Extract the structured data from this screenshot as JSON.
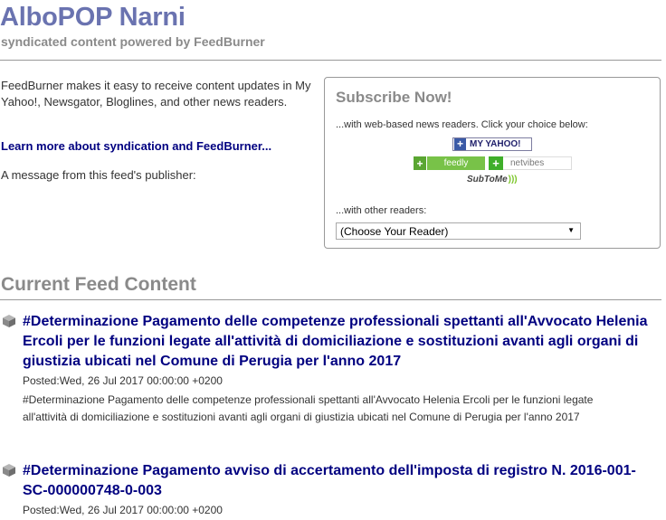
{
  "header": {
    "title": "AlboPOP Narni",
    "subtitle": "syndicated content powered by FeedBurner"
  },
  "intro": {
    "text": "FeedBurner makes it easy to receive content updates in My Yahoo!, Newsgator, Bloglines, and other news readers.",
    "learn_more_link": "Learn more about syndication and FeedBurner...",
    "publisher_message": "A message from this feed's publisher:"
  },
  "subscribe": {
    "title": "Subscribe Now!",
    "web_readers_text": "...with web-based news readers. Click your choice below:",
    "buttons": {
      "myyahoo": "MY YAHOO!",
      "feedly": "feedly",
      "netvibes": "netvibes",
      "subtome": "SubToMe"
    },
    "other_readers_text": "...with other readers:",
    "select_value": "(Choose Your Reader)"
  },
  "content": {
    "heading": "Current Feed Content",
    "items": [
      {
        "title": "#Determinazione Pagamento delle competenze professionali spettanti all'Avvocato Helenia Ercoli per le funzioni legate all'attività di domiciliazione e sostituzioni avanti agli organi di giustizia ubicati nel Comune di Perugia per l'anno 2017",
        "posted": "Posted:Wed, 26 Jul 2017 00:00:00 +0200",
        "body": "#Determinazione Pagamento delle competenze professionali spettanti all'Avvocato Helenia Ercoli per le funzioni legate all'attività di domiciliazione e sostituzioni avanti agli organi di giustizia ubicati nel Comune di Perugia per l'anno 2017"
      },
      {
        "title": "#Determinazione Pagamento avviso di accertamento dell'imposta di registro N. 2016-001-SC-000000748-0-003",
        "posted": "Posted:Wed, 26 Jul 2017 00:00:00 +0200"
      }
    ]
  },
  "colors": {
    "title": "#6a73b0",
    "link": "#000080",
    "muted_heading": "#8a8a8a",
    "feedly_green": "#78c248"
  },
  "icons": {
    "feed_item": "grey-cube-icon",
    "add": "plus-icon",
    "dropdown": "chevron-down-icon"
  }
}
